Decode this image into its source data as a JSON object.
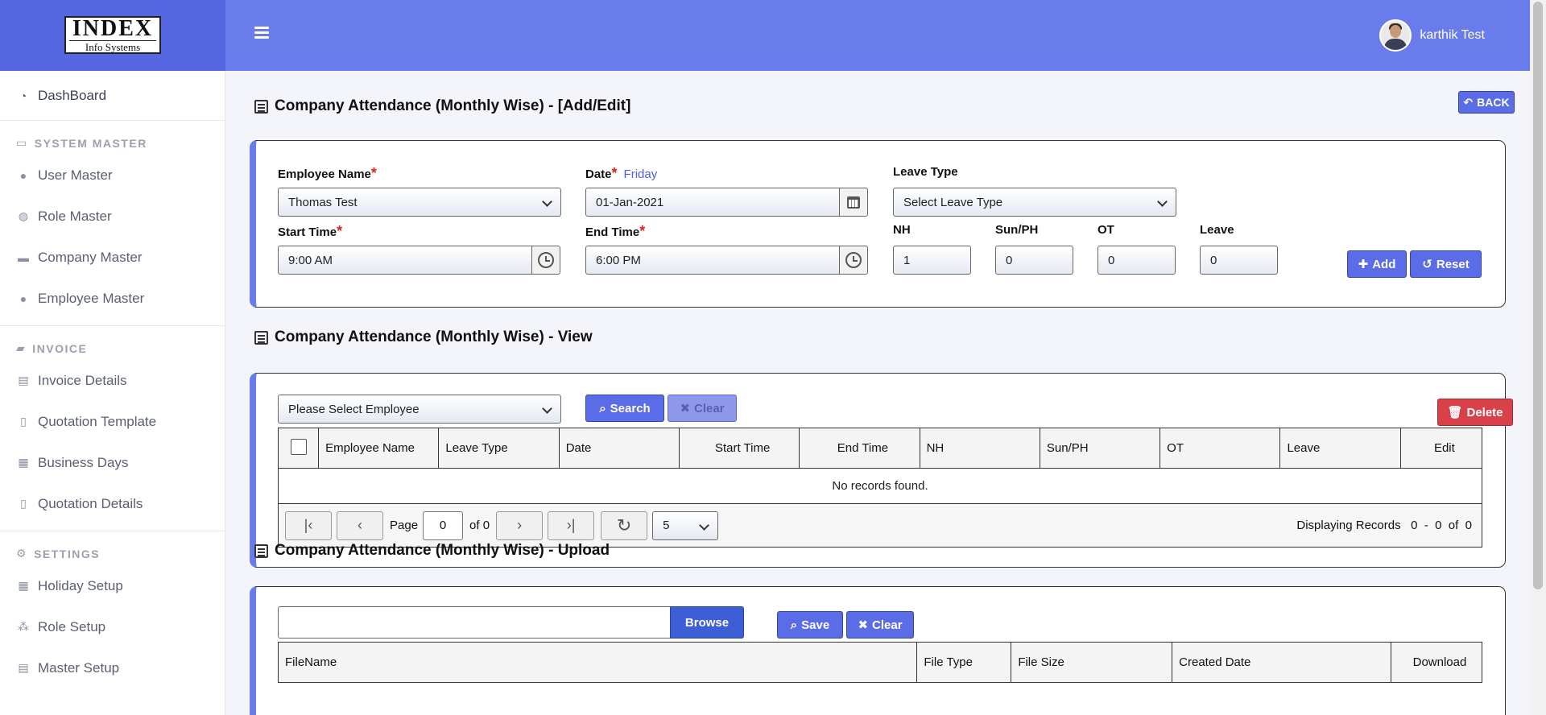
{
  "header": {
    "logo_line1": "INDEX",
    "logo_line2": "Info Systems",
    "user_name": "karthik Test"
  },
  "sidebar": {
    "dashboard": "DashBoard",
    "sections": [
      {
        "title": "SYSTEM MASTER",
        "items": [
          "User Master",
          "Role Master",
          "Company Master",
          "Employee Master"
        ]
      },
      {
        "title": "INVOICE",
        "items": [
          "Invoice Details",
          "Quotation Template",
          "Business Days",
          "Quotation Details"
        ]
      },
      {
        "title": "SETTINGS",
        "items": [
          "Holiday Setup",
          "Role Setup",
          "Master Setup"
        ]
      }
    ]
  },
  "add_edit": {
    "title": "Company Attendance (Monthly Wise) - [Add/Edit]",
    "back_label": "BACK",
    "employee_label": "Employee Name",
    "employee_value": "Thomas Test",
    "date_label": "Date",
    "date_day": "Friday",
    "date_value": "01-Jan-2021",
    "leave_type_label": "Leave Type",
    "leave_type_value": "Select Leave Type",
    "start_time_label": "Start Time",
    "start_time_value": "9:00 AM",
    "end_time_label": "End Time",
    "end_time_value": "6:00 PM",
    "nh_label": "NH",
    "nh_value": "1",
    "sunph_label": "Sun/PH",
    "sunph_value": "0",
    "ot_label": "OT",
    "ot_value": "0",
    "leave_label": "Leave",
    "leave_value": "0",
    "required_mark": "*",
    "add_label": "Add",
    "reset_label": "Reset"
  },
  "view": {
    "title": "Company Attendance (Monthly Wise) - View",
    "employee_select": "Please Select Employee",
    "search_label": "Search",
    "clear_label": "Clear",
    "delete_label": "Delete",
    "columns": [
      "Employee Name",
      "Leave Type",
      "Date",
      "Start Time",
      "End Time",
      "NH",
      "Sun/PH",
      "OT",
      "Leave",
      "Edit"
    ],
    "empty_message": "No records found.",
    "page_label": "Page",
    "page_value": "0",
    "of_label": "of 0",
    "page_size": "5",
    "display_info": "Displaying Records   0  -  0  of  0"
  },
  "upload": {
    "title": "Company Attendance (Monthly Wise) - Upload",
    "browse_label": "Browse",
    "save_label": "Save",
    "clear_label": "Clear",
    "columns": [
      "FileName",
      "File Type",
      "File Size",
      "Created Date",
      "Download"
    ]
  },
  "colors": {
    "accent": "#6a7bec",
    "sidebar_header": "#5466e0",
    "danger": "#d9414a"
  }
}
